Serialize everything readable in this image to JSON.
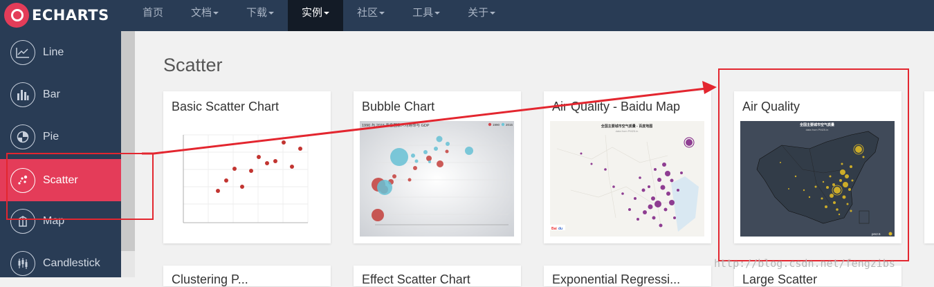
{
  "header": {
    "brand": "ECHARTS",
    "nav": [
      {
        "label": "首页",
        "caret": false
      },
      {
        "label": "文档",
        "caret": true
      },
      {
        "label": "下载",
        "caret": true
      },
      {
        "label": "实例",
        "caret": true,
        "active": true
      },
      {
        "label": "社区",
        "caret": true
      },
      {
        "label": "工具",
        "caret": true
      },
      {
        "label": "关于",
        "caret": true
      }
    ]
  },
  "sidebar": {
    "items": [
      {
        "label": "Line",
        "icon": "line-chart-icon"
      },
      {
        "label": "Bar",
        "icon": "bar-chart-icon"
      },
      {
        "label": "Pie",
        "icon": "pie-chart-icon"
      },
      {
        "label": "Scatter",
        "icon": "scatter-chart-icon",
        "active": true
      },
      {
        "label": "Map",
        "icon": "map-icon"
      },
      {
        "label": "Candlestick",
        "icon": "candlestick-icon"
      }
    ]
  },
  "main": {
    "section_title": "Scatter",
    "cards": [
      {
        "title": "Basic Scatter Chart"
      },
      {
        "title": "Bubble Chart"
      },
      {
        "title": "Air Quality - Baidu Map"
      },
      {
        "title": "Air Quality"
      }
    ],
    "partial_cards": [
      "Clustering P...",
      "Effect Scatter Chart",
      "Exponential Regressi...",
      "Large Scatter"
    ]
  },
  "thumbnails": {
    "bubble_title": "1990 与 2015 年各国家人均寿命与 GDP",
    "bubble_legend": [
      "1990",
      "2015"
    ],
    "baidu_title": "全国主要城市空气质量 - 百度地图",
    "baidu_subtitle": "data from PM25.in",
    "aq_title": "全国主要城市空气质量",
    "aq_subtitle": "data from PM25.in",
    "aq_legend": "pm2.5"
  },
  "annotations": {
    "watermark": "http://blog.csdn.net/fengzibs"
  },
  "colors": {
    "nav_bg": "#293c55",
    "accent": "#e43c59",
    "annotation_red": "#e3262f"
  }
}
